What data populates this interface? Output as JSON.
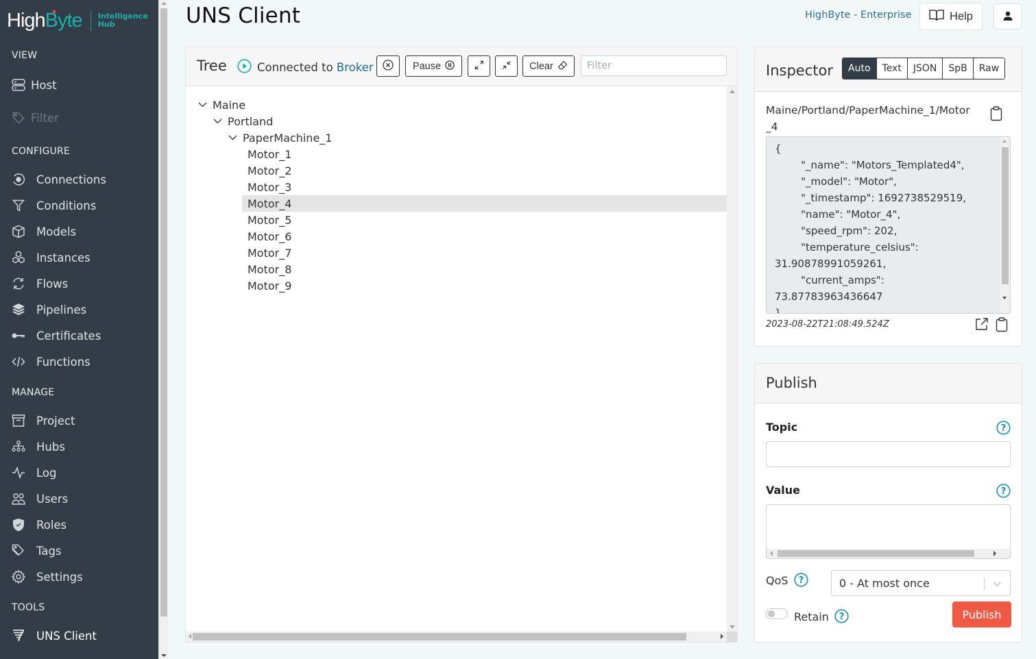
{
  "app": {
    "logo": {
      "high": "High",
      "byte": "Byte",
      "sub_line1": "Intelligence",
      "sub_line2": "Hub"
    },
    "edition": "HighByte - Enterprise",
    "help_label": "Help"
  },
  "sidebar": {
    "sections": [
      {
        "title": "VIEW",
        "items": [
          {
            "label": "Host",
            "icon": "server-icon",
            "disabled": false
          },
          {
            "label": "Filter",
            "icon": "tag-icon",
            "disabled": true
          }
        ]
      },
      {
        "title": "CONFIGURE",
        "items": [
          {
            "label": "Connections",
            "icon": "plug-icon"
          },
          {
            "label": "Conditions",
            "icon": "funnel-icon"
          },
          {
            "label": "Models",
            "icon": "box-icon"
          },
          {
            "label": "Instances",
            "icon": "boxes-icon"
          },
          {
            "label": "Flows",
            "icon": "refresh-icon"
          },
          {
            "label": "Pipelines",
            "icon": "layers-icon"
          },
          {
            "label": "Certificates",
            "icon": "key-icon"
          },
          {
            "label": "Functions",
            "icon": "code-icon"
          }
        ]
      },
      {
        "title": "MANAGE",
        "items": [
          {
            "label": "Project",
            "icon": "archive-icon"
          },
          {
            "label": "Hubs",
            "icon": "hierarchy-icon"
          },
          {
            "label": "Log",
            "icon": "pulse-icon"
          },
          {
            "label": "Users",
            "icon": "users-icon"
          },
          {
            "label": "Roles",
            "icon": "shield-icon"
          },
          {
            "label": "Tags",
            "icon": "tags-icon"
          },
          {
            "label": "Settings",
            "icon": "gear-icon"
          }
        ]
      },
      {
        "title": "TOOLS",
        "items": [
          {
            "label": "UNS Client",
            "icon": "tornado-icon",
            "active": true
          }
        ]
      }
    ]
  },
  "page": {
    "title": "UNS Client"
  },
  "tree": {
    "title": "Tree",
    "status_prefix": "Connected to",
    "status_link": "Broker",
    "pause_label": "Pause",
    "clear_label": "Clear",
    "filter_placeholder": "Filter",
    "filter_value": "",
    "nodes": [
      {
        "label": "Maine",
        "depth": 0,
        "expanded": true
      },
      {
        "label": "Portland",
        "depth": 1,
        "expanded": true
      },
      {
        "label": "PaperMachine_1",
        "depth": 2,
        "expanded": true
      },
      {
        "label": "Motor_1",
        "depth": 3
      },
      {
        "label": "Motor_2",
        "depth": 3
      },
      {
        "label": "Motor_3",
        "depth": 3
      },
      {
        "label": "Motor_4",
        "depth": 3,
        "selected": true
      },
      {
        "label": "Motor_5",
        "depth": 3
      },
      {
        "label": "Motor_6",
        "depth": 3
      },
      {
        "label": "Motor_7",
        "depth": 3
      },
      {
        "label": "Motor_8",
        "depth": 3
      },
      {
        "label": "Motor_9",
        "depth": 3
      }
    ]
  },
  "inspector": {
    "title": "Inspector",
    "modes": [
      "Auto",
      "Text",
      "JSON",
      "SpB",
      "Raw"
    ],
    "active_mode": "Auto",
    "topic": "Maine/Portland/PaperMachine_1/Motor_4",
    "payload": "{\n        \"_name\": \"Motors_Templated4\",\n        \"_model\": \"Motor\",\n        \"_timestamp\": 1692738529519,\n        \"name\": \"Motor_4\",\n        \"speed_rpm\": 202,\n        \"temperature_celsius\": 31.90878991059261,\n        \"current_amps\": 73.87783963436647\n}",
    "timestamp": "2023-08-22T21:08:49.524Z"
  },
  "publish": {
    "title": "Publish",
    "topic_label": "Topic",
    "topic_value": "",
    "value_label": "Value",
    "value_value": "",
    "qos_label": "QoS",
    "qos_selected": "0 - At most once",
    "retain_label": "Retain",
    "retain_on": false,
    "publish_label": "Publish"
  },
  "colors": {
    "sidebar_bg": "#333d47",
    "brand_teal": "#1bb0a8",
    "link": "#1d6a8f",
    "publish_button": "#f05a44",
    "help_icon": "#1b8fc2"
  }
}
